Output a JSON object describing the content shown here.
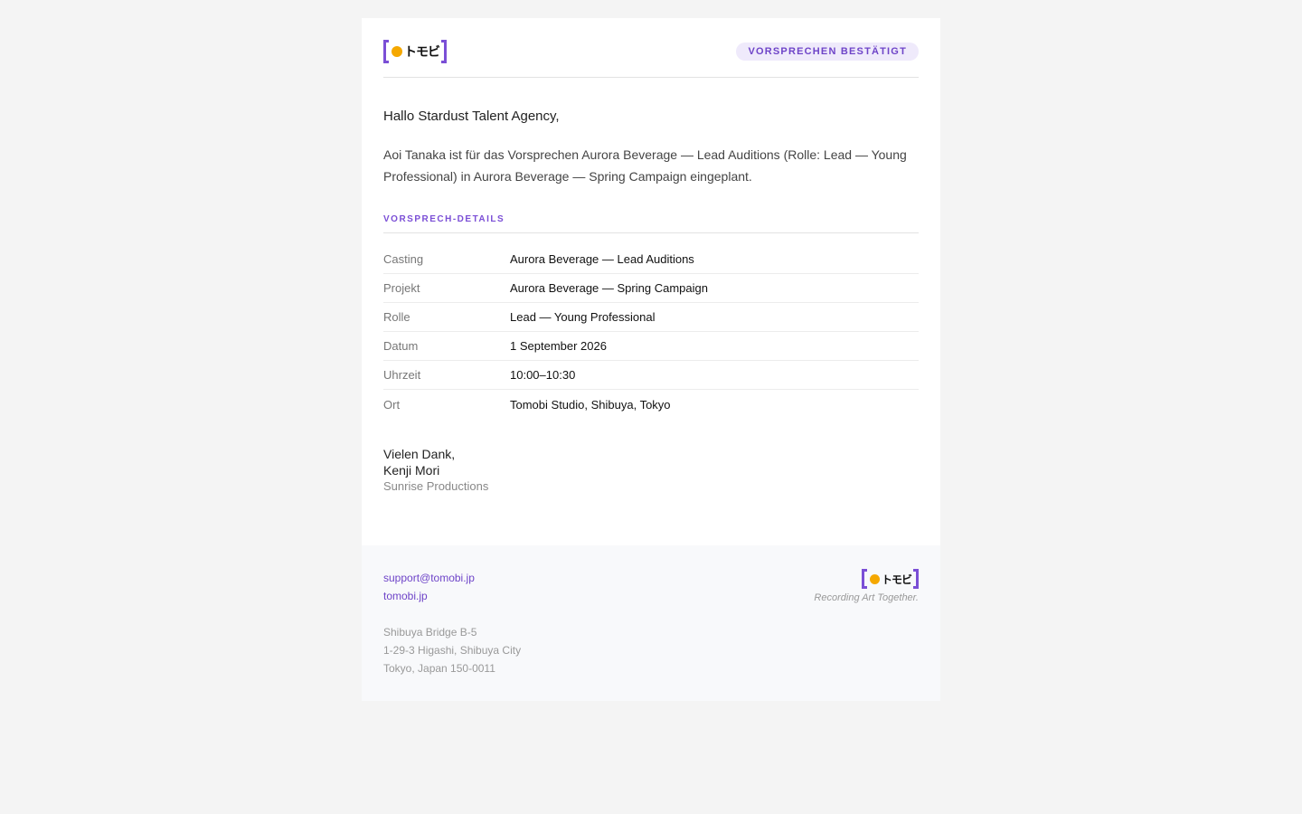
{
  "brand": {
    "logo_text": "トモビ",
    "tagline": "Recording Art Together.",
    "colors": {
      "accent": "#7b4fd6",
      "dot": "#f5a800"
    }
  },
  "header": {
    "badge": "VORSPRECHEN BESTÄTIGT"
  },
  "greeting": "Hallo Stardust Talent Agency,",
  "intro": "Aoi Tanaka ist für das Vorsprechen Aurora Beverage — Lead Auditions (Rolle: Lead — Young Professional) in Aurora Beverage — Spring Campaign eingeplant.",
  "details": {
    "title": "VORSPRECH-DETAILS",
    "rows": [
      {
        "label": "Casting",
        "value": "Aurora Beverage — Lead Auditions"
      },
      {
        "label": "Projekt",
        "value": "Aurora Beverage — Spring Campaign"
      },
      {
        "label": "Rolle",
        "value": "Lead — Young Professional"
      },
      {
        "label": "Datum",
        "value": "1 September 2026"
      },
      {
        "label": "Uhrzeit",
        "value": "10:00–10:30"
      },
      {
        "label": "Ort",
        "value": "Tomobi Studio, Shibuya, Tokyo"
      }
    ]
  },
  "signoff": {
    "closing": "Vielen Dank,",
    "name": "Kenji Mori",
    "company": "Sunrise Productions"
  },
  "footer": {
    "email": "support@tomobi.jp",
    "website": "tomobi.jp",
    "address": [
      "Shibuya Bridge B-5",
      "1-29-3 Higashi, Shibuya City",
      "Tokyo, Japan 150-0011"
    ]
  }
}
